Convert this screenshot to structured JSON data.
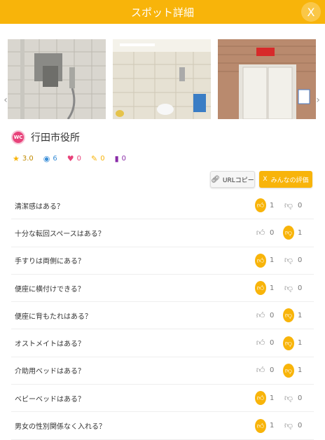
{
  "header": {
    "title": "スポット詳細",
    "close_label": "X"
  },
  "spot": {
    "logo_text": "WC",
    "name": "行田市役所"
  },
  "stats": {
    "rating": "3.0",
    "views": "6",
    "likes": "0",
    "reviews": "0",
    "bookmarks": "0"
  },
  "buttons": {
    "url_copy": "URLコピー",
    "evaluate": "みんなの評価",
    "evaluate_icon": "X"
  },
  "icons": {
    "star": "star-icon",
    "eye": "eye-icon",
    "heart": "heart-icon",
    "pencil": "pencil-icon",
    "bookmark": "bookmark-icon",
    "link": "link-icon",
    "thumb_up": "thumbs-up-icon",
    "thumb_down": "thumbs-down-icon"
  },
  "colors": {
    "accent": "#f8b40a",
    "star": "#f8b40a",
    "eye": "#3b8fd8",
    "heart": "#e8427a",
    "pencil": "#f8b40a",
    "bookmark": "#8a2ca8"
  },
  "questions": [
    {
      "text": "清潔感はある？",
      "up": "1",
      "down": "0",
      "selected": "up"
    },
    {
      "text": "十分な転回スペースはある？",
      "up": "0",
      "down": "1",
      "selected": "down"
    },
    {
      "text": "手すりは両側にある？",
      "up": "1",
      "down": "0",
      "selected": "up"
    },
    {
      "text": "便座に横付けできる？",
      "up": "1",
      "down": "0",
      "selected": "up"
    },
    {
      "text": "便座に背もたれはある？",
      "up": "0",
      "down": "1",
      "selected": "down"
    },
    {
      "text": "オストメイトはある？",
      "up": "0",
      "down": "1",
      "selected": "down"
    },
    {
      "text": "介助用ベッドはある？",
      "up": "0",
      "down": "1",
      "selected": "down"
    },
    {
      "text": "ベビーベッドはある？",
      "up": "1",
      "down": "0",
      "selected": "up"
    },
    {
      "text": "男女の性別関係なく入れる？",
      "up": "1",
      "down": "0",
      "selected": "up"
    }
  ]
}
